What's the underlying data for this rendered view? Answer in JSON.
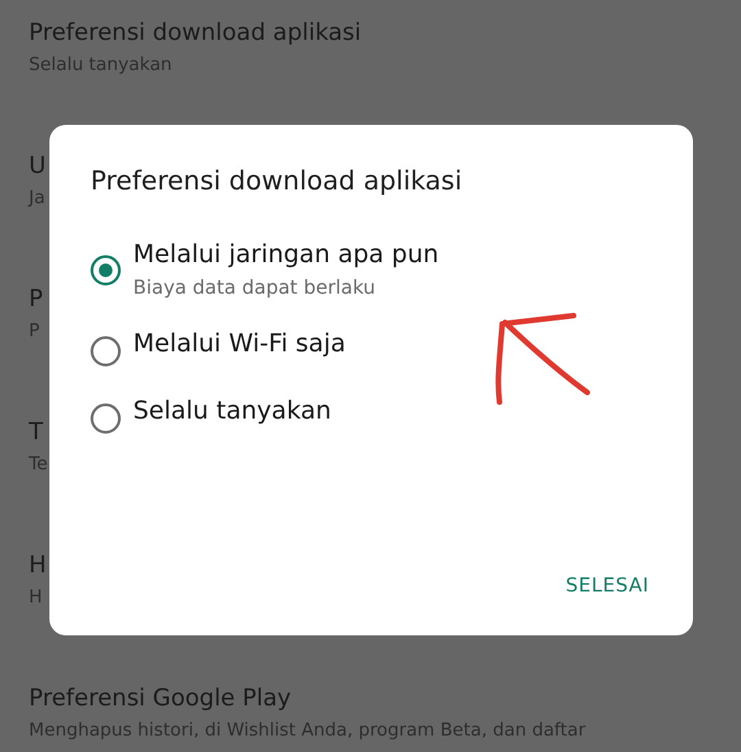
{
  "settings_list": [
    {
      "title": "Preferensi download aplikasi",
      "subtitle": "Selalu tanyakan"
    },
    {
      "title": "U",
      "subtitle": "Ja"
    },
    {
      "title": "P",
      "subtitle": "P"
    },
    {
      "title": "T",
      "subtitle": "Te"
    },
    {
      "title": "H",
      "subtitle": "H"
    },
    {
      "title": "Preferensi Google Play",
      "subtitle": "Menghapus histori, di Wishlist Anda, program Beta, dan daftar"
    }
  ],
  "dialog": {
    "title": "Preferensi download aplikasi",
    "options": [
      {
        "label": "Melalui jaringan apa pun",
        "description": "Biaya data dapat berlaku",
        "selected": true
      },
      {
        "label": "Melalui Wi-Fi saja",
        "selected": false
      },
      {
        "label": "Selalu tanyakan",
        "selected": false
      }
    ],
    "button": "SELESAI"
  }
}
